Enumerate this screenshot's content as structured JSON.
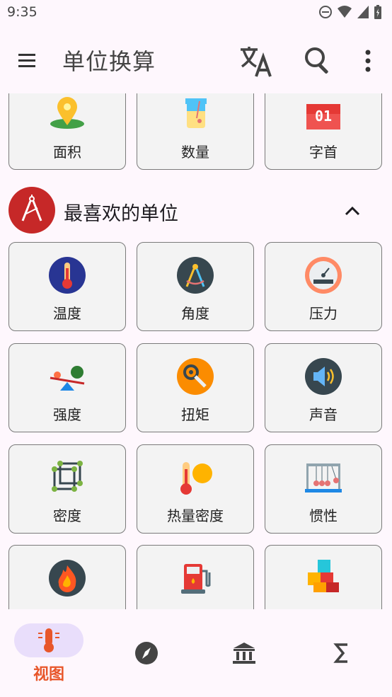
{
  "status_bar": {
    "time": "9:35"
  },
  "app_bar": {
    "title": "单位换算",
    "icons": [
      "menu-icon",
      "translate-icon",
      "search-icon",
      "more-vert-icon"
    ]
  },
  "top_row": [
    {
      "label": "面积",
      "icon": "map-pin-icon"
    },
    {
      "label": "数量",
      "icon": "beaker-icon"
    },
    {
      "label": "字首",
      "icon": "calendar-01-icon"
    }
  ],
  "favorites": {
    "title": "最喜欢的单位",
    "icon": "compass-drawing-icon",
    "items": [
      {
        "label": "温度",
        "icon": "thermometer-icon"
      },
      {
        "label": "角度",
        "icon": "compass-icon"
      },
      {
        "label": "压力",
        "icon": "pressure-gauge-icon"
      },
      {
        "label": "强度",
        "icon": "seesaw-icon"
      },
      {
        "label": "扭矩",
        "icon": "wrench-gear-icon"
      },
      {
        "label": "声音",
        "icon": "speaker-icon"
      },
      {
        "label": "密度",
        "icon": "cube-nodes-icon"
      },
      {
        "label": "热量密度",
        "icon": "heat-thermometer-icon"
      },
      {
        "label": "惯性",
        "icon": "newtons-cradle-icon"
      },
      {
        "label": "",
        "icon": "fire-icon"
      },
      {
        "label": "",
        "icon": "fuel-pump-icon"
      },
      {
        "label": "",
        "icon": "cubes-icon"
      }
    ]
  },
  "bottom_nav": {
    "items": [
      {
        "label": "视图",
        "icon": "thermometer-view-icon",
        "active": true
      },
      {
        "label": "",
        "icon": "explore-icon",
        "active": false
      },
      {
        "label": "",
        "icon": "bank-icon",
        "active": false
      },
      {
        "label": "",
        "icon": "sigma-icon",
        "active": false
      }
    ]
  },
  "colors": {
    "accent": "#e8562a",
    "active_pill": "#e9defb",
    "background": "#fef7fd",
    "card_bg": "#f3f3f3",
    "fav_icon_bg": "#c62828"
  }
}
